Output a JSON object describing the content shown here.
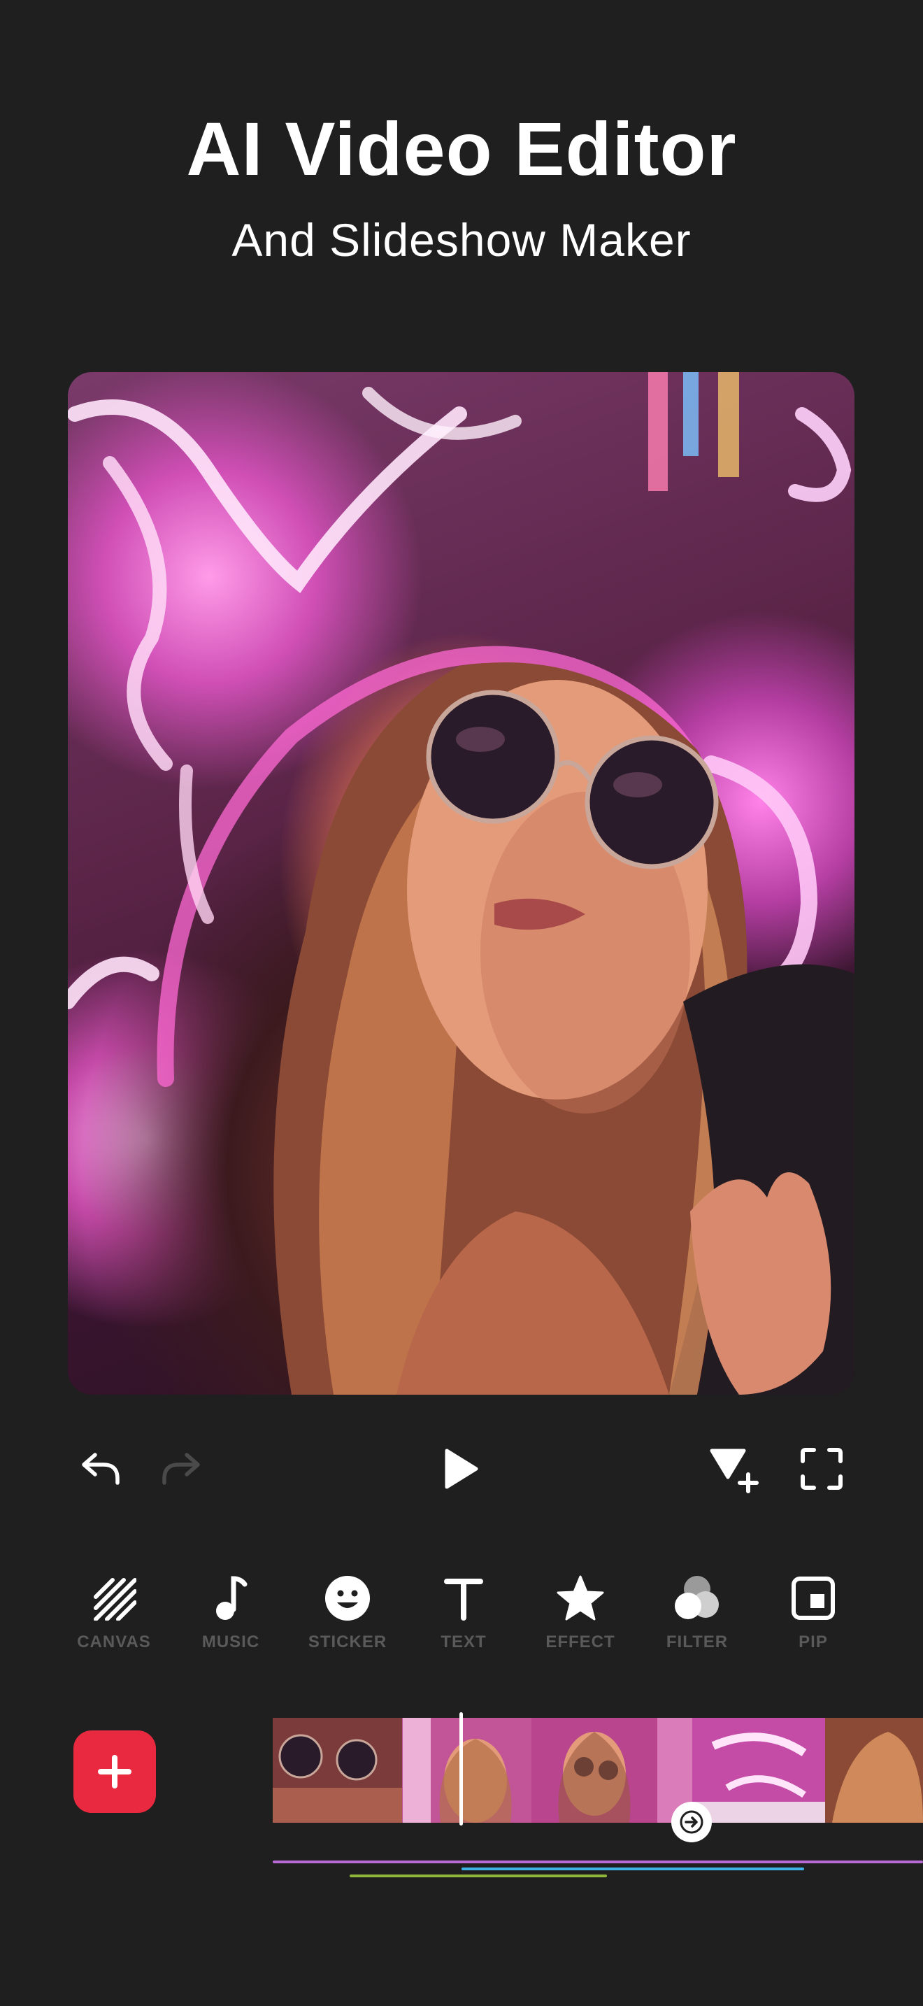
{
  "header": {
    "title": "AI Video Editor",
    "subtitle": "And Slideshow Maker"
  },
  "playback_controls": {
    "undo_icon": "undo-arrow-icon",
    "redo_icon": "redo-arrow-icon",
    "play_icon": "play-icon",
    "keyframe_icon": "keyframe-add-icon",
    "fullscreen_icon": "fullscreen-icon"
  },
  "toolbar": {
    "items": [
      {
        "label": "CANVAS",
        "icon": "canvas-icon"
      },
      {
        "label": "MUSIC",
        "icon": "music-note-icon"
      },
      {
        "label": "STICKER",
        "icon": "smiley-icon"
      },
      {
        "label": "TEXT",
        "icon": "text-t-icon"
      },
      {
        "label": "EFFECT",
        "icon": "star-icon"
      },
      {
        "label": "FILTER",
        "icon": "filter-circles-icon"
      },
      {
        "label": "PIP",
        "icon": "pip-icon"
      }
    ]
  },
  "timeline": {
    "add_icon": "plus-icon",
    "transition_icon": "arrow-right-icon",
    "colors": {
      "music_track": "#b86ad6",
      "text_track": "#3bb3e6",
      "effect_track": "#8fb53a",
      "add_button": "#e8293f"
    }
  }
}
